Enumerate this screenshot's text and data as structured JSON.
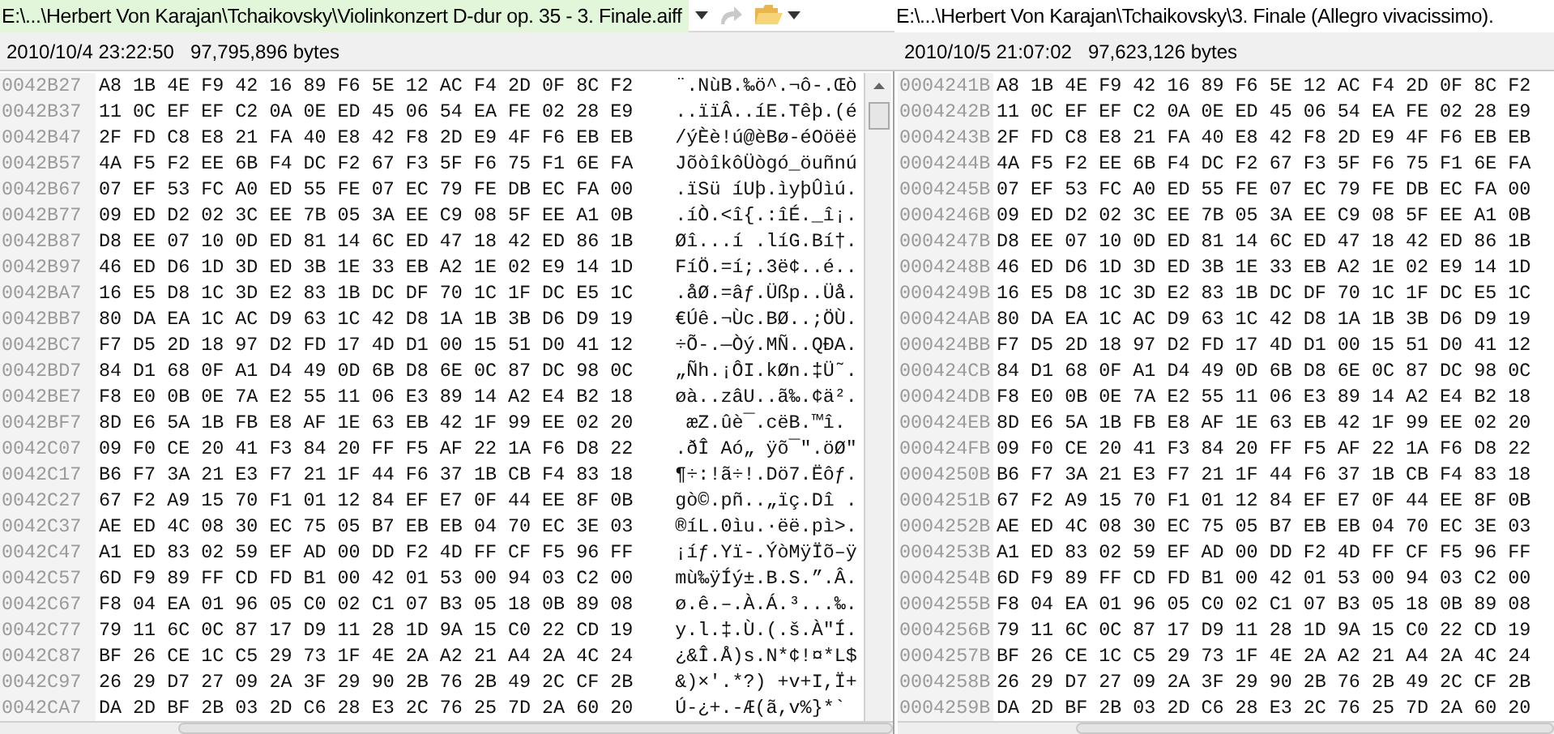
{
  "left_pane": {
    "selected": true,
    "path": "E:\\...\\Herbert Von Karajan\\Tchaikovsky\\Violinkonzert D-dur op. 35 - 3. Finale.aiff",
    "timestamp": "2010/10/4 23:22:50",
    "size": "97,795,896 bytes",
    "rows": [
      {
        "address": "0042B27",
        "hex": "A8 1B 4E F9 42 16 89 F6 5E 12 AC F4 2D 0F 8C F2",
        "ascii": "¨.NùB.‰ö^.¬ô-.Œò"
      },
      {
        "address": "0042B37",
        "hex": "11 0C EF EF C2 0A 0E ED 45 06 54 EA FE 02 28 E9",
        "ascii": "..ïïÂ..íE.Têþ.(é"
      },
      {
        "address": "0042B47",
        "hex": "2F FD C8 E8 21 FA 40 E8 42 F8 2D E9 4F F6 EB EB",
        "ascii": "/ýÈè!ú@èBø-éOöëë"
      },
      {
        "address": "0042B57",
        "hex": "4A F5 F2 EE 6B F4 DC F2 67 F3 5F F6 75 F1 6E FA",
        "ascii": "JõòîkôÜògó_öuñnú"
      },
      {
        "address": "0042B67",
        "hex": "07 EF 53 FC A0 ED 55 FE 07 EC 79 FE DB EC FA 00",
        "ascii": ".ïSü íUþ.ìyþÛìú."
      },
      {
        "address": "0042B77",
        "hex": "09 ED D2 02 3C EE 7B 05 3A EE C9 08 5F EE A1 0B",
        "ascii": ".íÒ.<î{.:îÉ._î¡."
      },
      {
        "address": "0042B87",
        "hex": "D8 EE 07 10 0D ED 81 14 6C ED 47 18 42 ED 86 1B",
        "ascii": "Øî...í .líG.Bí†."
      },
      {
        "address": "0042B97",
        "hex": "46 ED D6 1D 3D ED 3B 1E 33 EB A2 1E 02 E9 14 1D",
        "ascii": "FíÖ.=í;.3ë¢..é.."
      },
      {
        "address": "0042BA7",
        "hex": "16 E5 D8 1C 3D E2 83 1B DC DF 70 1C 1F DC E5 1C",
        "ascii": ".åØ.=âƒ.Üßp..Üå."
      },
      {
        "address": "0042BB7",
        "hex": "80 DA EA 1C AC D9 63 1C 42 D8 1A 1B 3B D6 D9 19",
        "ascii": "€Úê.¬Ùc.BØ..;ÖÙ."
      },
      {
        "address": "0042BC7",
        "hex": "F7 D5 2D 18 97 D2 FD 17 4D D1 00 15 51 D0 41 12",
        "ascii": "÷Õ-.—Òý.MÑ..QÐA."
      },
      {
        "address": "0042BD7",
        "hex": "84 D1 68 0F A1 D4 49 0D 6B D8 6E 0C 87 DC 98 0C",
        "ascii": "„Ñh.¡ÔI.kØn.‡Ü˜."
      },
      {
        "address": "0042BE7",
        "hex": "F8 E0 0B 0E 7A E2 55 11 06 E3 89 14 A2 E4 B2 18",
        "ascii": "øà..zâU..ã‰.¢ä²."
      },
      {
        "address": "0042BF7",
        "hex": "8D E6 5A 1B FB E8 AF 1E 63 EB 42 1F 99 EE 02 20",
        "ascii": " æZ.ûè¯.cëB.™î."
      },
      {
        "address": "0042C07",
        "hex": "09 F0 CE 20 41 F3 84 20 FF F5 AF 22 1A F6 D8 22",
        "ascii": ".ðÎ Aó„ ÿõ¯\".öØ\""
      },
      {
        "address": "0042C17",
        "hex": "B6 F7 3A 21 E3 F7 21 1F 44 F6 37 1B CB F4 83 18",
        "ascii": "¶÷:!ã÷!.Dö7.Ëôƒ."
      },
      {
        "address": "0042C27",
        "hex": "67 F2 A9 15 70 F1 01 12 84 EF E7 0F 44 EE 8F 0B",
        "ascii": "gò©.pñ..„ïç.Dî ."
      },
      {
        "address": "0042C37",
        "hex": "AE ED 4C 08 30 EC 75 05 B7 EB EB 04 70 EC 3E 03",
        "ascii": "®íL.0ìu.·ëë.pì>."
      },
      {
        "address": "0042C47",
        "hex": "A1 ED 83 02 59 EF AD 00 DD F2 4D FF CF F5 96 FF",
        "ascii": "¡íƒ.Yï-.ÝòMÿÏõ–ÿ"
      },
      {
        "address": "0042C57",
        "hex": "6D F9 89 FF CD FD B1 00 42 01 53 00 94 03 C2 00",
        "ascii": "mù‰ÿÍý±.B.S.”.Â."
      },
      {
        "address": "0042C67",
        "hex": "F8 04 EA 01 96 05 C0 02 C1 07 B3 05 18 0B 89 08",
        "ascii": "ø.ê.–.À.Á.³...‰."
      },
      {
        "address": "0042C77",
        "hex": "79 11 6C 0C 87 17 D9 11 28 1D 9A 15 C0 22 CD 19",
        "ascii": "y.l.‡.Ù.(.š.À\"Í."
      },
      {
        "address": "0042C87",
        "hex": "BF 26 CE 1C C5 29 73 1F 4E 2A A2 21 A4 2A 4C 24",
        "ascii": "¿&Î.Å)s.N*¢!¤*L$"
      },
      {
        "address": "0042C97",
        "hex": "26 29 D7 27 09 2A 3F 29 90 2B 76 2B 49 2C CF 2B",
        "ascii": "&)×'.*?) +v+I,Ï+"
      },
      {
        "address": "0042CA7",
        "hex": "DA 2D BF 2B 03 2D C6 28 E3 2C 76 25 7D 2A 60 20",
        "ascii": "Ú-¿+.-Æ(ã,v%}*`"
      }
    ]
  },
  "right_pane": {
    "selected": false,
    "path": "E:\\...\\Herbert Von Karajan\\Tchaikovsky\\3. Finale (Allegro vivacissimo).",
    "timestamp": "2010/10/5 21:07:02",
    "size": "97,623,126 bytes",
    "rows": [
      {
        "address": "0004241B",
        "hex": "A8 1B 4E F9 42 16 89 F6 5E 12 AC F4 2D 0F 8C F2"
      },
      {
        "address": "0004242B",
        "hex": "11 0C EF EF C2 0A 0E ED 45 06 54 EA FE 02 28 E9"
      },
      {
        "address": "0004243B",
        "hex": "2F FD C8 E8 21 FA 40 E8 42 F8 2D E9 4F F6 EB EB"
      },
      {
        "address": "0004244B",
        "hex": "4A F5 F2 EE 6B F4 DC F2 67 F3 5F F6 75 F1 6E FA"
      },
      {
        "address": "0004245B",
        "hex": "07 EF 53 FC A0 ED 55 FE 07 EC 79 FE DB EC FA 00"
      },
      {
        "address": "0004246B",
        "hex": "09 ED D2 02 3C EE 7B 05 3A EE C9 08 5F EE A1 0B"
      },
      {
        "address": "0004247B",
        "hex": "D8 EE 07 10 0D ED 81 14 6C ED 47 18 42 ED 86 1B"
      },
      {
        "address": "0004248B",
        "hex": "46 ED D6 1D 3D ED 3B 1E 33 EB A2 1E 02 E9 14 1D"
      },
      {
        "address": "0004249B",
        "hex": "16 E5 D8 1C 3D E2 83 1B DC DF 70 1C 1F DC E5 1C"
      },
      {
        "address": "000424AB",
        "hex": "80 DA EA 1C AC D9 63 1C 42 D8 1A 1B 3B D6 D9 19"
      },
      {
        "address": "000424BB",
        "hex": "F7 D5 2D 18 97 D2 FD 17 4D D1 00 15 51 D0 41 12"
      },
      {
        "address": "000424CB",
        "hex": "84 D1 68 0F A1 D4 49 0D 6B D8 6E 0C 87 DC 98 0C"
      },
      {
        "address": "000424DB",
        "hex": "F8 E0 0B 0E 7A E2 55 11 06 E3 89 14 A2 E4 B2 18"
      },
      {
        "address": "000424EB",
        "hex": "8D E6 5A 1B FB E8 AF 1E 63 EB 42 1F 99 EE 02 20"
      },
      {
        "address": "000424FB",
        "hex": "09 F0 CE 20 41 F3 84 20 FF F5 AF 22 1A F6 D8 22"
      },
      {
        "address": "0004250B",
        "hex": "B6 F7 3A 21 E3 F7 21 1F 44 F6 37 1B CB F4 83 18"
      },
      {
        "address": "0004251B",
        "hex": "67 F2 A9 15 70 F1 01 12 84 EF E7 0F 44 EE 8F 0B"
      },
      {
        "address": "0004252B",
        "hex": "AE ED 4C 08 30 EC 75 05 B7 EB EB 04 70 EC 3E 03"
      },
      {
        "address": "0004253B",
        "hex": "A1 ED 83 02 59 EF AD 00 DD F2 4D FF CF F5 96 FF"
      },
      {
        "address": "0004254B",
        "hex": "6D F9 89 FF CD FD B1 00 42 01 53 00 94 03 C2 00"
      },
      {
        "address": "0004255B",
        "hex": "F8 04 EA 01 96 05 C0 02 C1 07 B3 05 18 0B 89 08"
      },
      {
        "address": "0004256B",
        "hex": "79 11 6C 0C 87 17 D9 11 28 1D 9A 15 C0 22 CD 19"
      },
      {
        "address": "0004257B",
        "hex": "BF 26 CE 1C C5 29 73 1F 4E 2A A2 21 A4 2A 4C 24"
      },
      {
        "address": "0004258B",
        "hex": "26 29 D7 27 09 2A 3F 29 90 2B 76 2B 49 2C CF 2B"
      },
      {
        "address": "0004259B",
        "hex": "DA 2D BF 2B 03 2D C6 28 E3 2C 76 25 7D 2A 60 20"
      }
    ]
  }
}
